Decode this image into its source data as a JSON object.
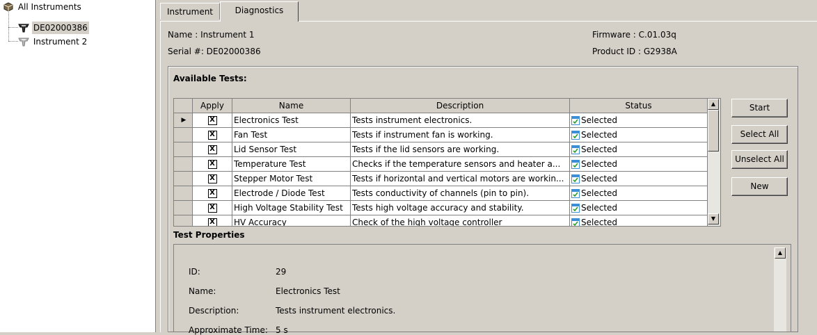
{
  "tree": {
    "root_label": "All Instruments",
    "nodes": [
      {
        "label": "DE02000386",
        "selected": true
      },
      {
        "label": "Instrument 2",
        "selected": false
      }
    ]
  },
  "tabs": [
    {
      "label": "Instrument",
      "active": false
    },
    {
      "label": "Diagnostics",
      "active": true
    }
  ],
  "info": {
    "name": "Name : Instrument 1",
    "serial": "Serial #: DE02000386",
    "firmware": "Firmware : C.01.03q",
    "product_id": "Product ID : G2938A"
  },
  "available_tests": {
    "title": "Available Tests:",
    "columns": [
      "Apply",
      "Name",
      "Description",
      "Status"
    ],
    "rows": [
      {
        "apply": "X",
        "name": "Electronics Test",
        "description": "Tests instrument electronics.",
        "status": "Selected"
      },
      {
        "apply": "X",
        "name": "Fan Test",
        "description": "Tests if instrument fan is working.",
        "status": "Selected"
      },
      {
        "apply": "X",
        "name": "Lid Sensor Test",
        "description": "Tests if the lid sensors are working.",
        "status": "Selected"
      },
      {
        "apply": "X",
        "name": "Temperature Test",
        "description": "Checks if the temperature sensors and heater a...",
        "status": "Selected"
      },
      {
        "apply": "X",
        "name": "Stepper Motor Test",
        "description": "Tests if horizontal and vertical motors are workin...",
        "status": "Selected"
      },
      {
        "apply": "X",
        "name": "Electrode / Diode Test",
        "description": "Tests conductivity of channels (pin to pin).",
        "status": "Selected"
      },
      {
        "apply": "X",
        "name": "High Voltage Stability Test",
        "description": "Tests high voltage accuracy and stability.",
        "status": "Selected"
      },
      {
        "apply": "X",
        "name": "HV Accuracy",
        "description": "Check of the high voltage controller",
        "status": "Selected"
      }
    ],
    "current_row_marker": "▶"
  },
  "buttons": {
    "start": "Start",
    "select_all": "Select All",
    "unselect_all": "Unselect All",
    "new": "New"
  },
  "test_properties": {
    "title": "Test Properties",
    "fields": [
      {
        "label": "ID:",
        "value": "29"
      },
      {
        "label": "Name:",
        "value": "Electronics Test"
      },
      {
        "label": "Description:",
        "value": "Tests instrument electronics."
      },
      {
        "label": "Approximate Time:",
        "value": "5 s"
      }
    ]
  },
  "icons": {
    "root": "instruments-root-icon",
    "instrument_active": "instrument-icon",
    "instrument_inactive": "instrument-disabled-icon",
    "status": "checklist-icon",
    "scroll_up": "scroll-up-arrow-icon",
    "scroll_down": "scroll-down-arrow-icon"
  },
  "colors": {
    "window_bg": "#d4d0c8",
    "grid_bg": "#ffffff",
    "status_icon": "#3c8fd6",
    "check_green": "#2a9d2a"
  }
}
